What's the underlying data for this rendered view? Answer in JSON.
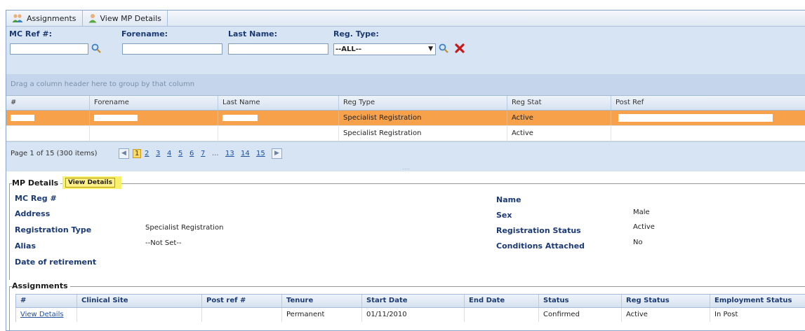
{
  "tabs": [
    {
      "label": "Assignments",
      "icon": "users-icon"
    },
    {
      "label": "View MP Details",
      "icon": "user-icon"
    }
  ],
  "filters": {
    "mc_ref_label": "MC Ref #:",
    "forename_label": "Forename:",
    "last_name_label": "Last Name:",
    "reg_type_label": "Reg. Type:",
    "reg_type_value": "--ALL--"
  },
  "grid": {
    "group_hint": "Drag a column header here to group by that column",
    "columns": [
      "#",
      "Forename",
      "Last Name",
      "Reg Type",
      "Reg Stat",
      "Post Ref"
    ],
    "rows": [
      {
        "reg_type": "Specialist Registration",
        "reg_stat": "Active"
      },
      {
        "reg_type": "Specialist Registration",
        "reg_stat": "Active"
      }
    ]
  },
  "pager": {
    "summary": "Page 1 of 15 (300 items)",
    "pages": [
      "1",
      "2",
      "3",
      "4",
      "5",
      "6",
      "7",
      "...",
      "13",
      "14",
      "15"
    ],
    "current": "1"
  },
  "mp_details": {
    "legend": "MP Details",
    "view_button": "View Details",
    "labels": {
      "mc_reg": "MC Reg #",
      "address": "Address",
      "reg_type": "Registration Type",
      "alias": "Alias",
      "retirement": "Date of retirement",
      "name": "Name",
      "sex": "Sex",
      "reg_status": "Registration Status",
      "conditions": "Conditions Attached"
    },
    "values": {
      "reg_type": "Specialist Registration",
      "alias": "--Not Set--",
      "sex": "Male",
      "reg_status": "Active",
      "conditions": "No"
    }
  },
  "assignments": {
    "legend": "Assignments",
    "columns": [
      "#",
      "Clinical Site",
      "Post ref #",
      "Tenure",
      "Start Date",
      "End Date",
      "Status",
      "Reg Status",
      "Employment Status"
    ],
    "row": {
      "link": "View Details",
      "tenure": "Permanent",
      "start_date": "01/11/2010",
      "status": "Confirmed",
      "reg_status": "Active",
      "employment_status": "In Post"
    }
  },
  "colors": {
    "selected_row": "#f7a14a",
    "header_blue": "#1b3a73",
    "highlight": "#f7f06a"
  }
}
